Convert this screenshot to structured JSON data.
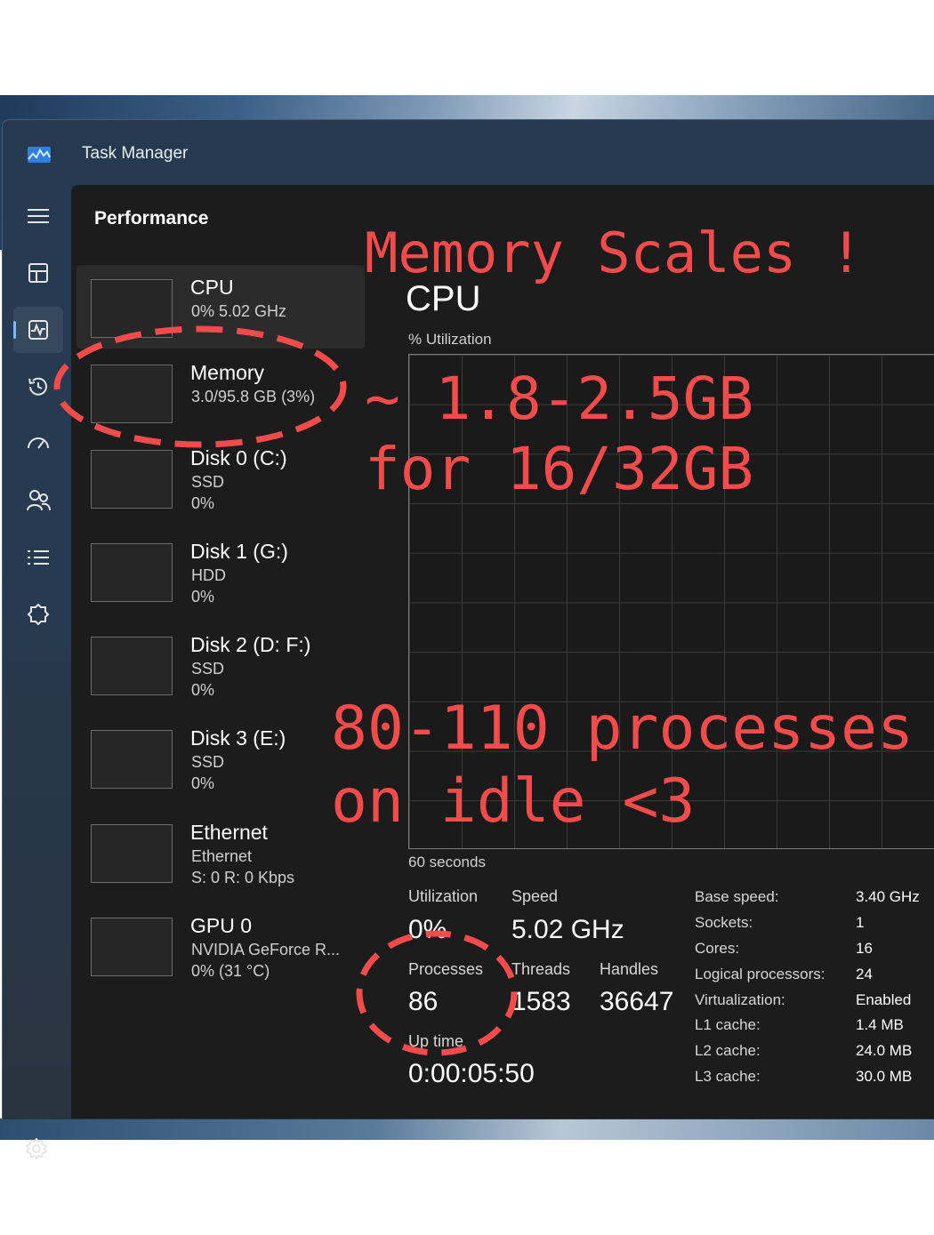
{
  "window": {
    "title": "Task Manager"
  },
  "page": {
    "title": "Performance"
  },
  "nav": {
    "items": [
      {
        "icon": "hamburger-menu-icon"
      },
      {
        "icon": "processes-icon"
      },
      {
        "icon": "performance-icon",
        "active": true
      },
      {
        "icon": "app-history-icon"
      },
      {
        "icon": "startup-apps-icon"
      },
      {
        "icon": "users-icon"
      },
      {
        "icon": "details-icon"
      },
      {
        "icon": "services-icon"
      }
    ],
    "settings_icon": "settings-gear-icon"
  },
  "resources": [
    {
      "name": "CPU",
      "sub1": "0%  5.02 GHz",
      "sub2": ""
    },
    {
      "name": "Memory",
      "sub1": "3.0/95.8 GB (3%)",
      "sub2": ""
    },
    {
      "name": "Disk 0 (C:)",
      "sub1": "SSD",
      "sub2": "0%"
    },
    {
      "name": "Disk 1 (G:)",
      "sub1": "HDD",
      "sub2": "0%"
    },
    {
      "name": "Disk 2 (D: F:)",
      "sub1": "SSD",
      "sub2": "0%"
    },
    {
      "name": "Disk 3 (E:)",
      "sub1": "SSD",
      "sub2": "0%"
    },
    {
      "name": "Ethernet",
      "sub1": "Ethernet",
      "sub2": "S: 0 R: 0 Kbps"
    },
    {
      "name": "GPU 0",
      "sub1": "NVIDIA GeForce R...",
      "sub2": "0%  (31 °C)"
    }
  ],
  "detail": {
    "title": "CPU",
    "graph_label": "% Utilization",
    "time_label": "60 seconds",
    "utilization_label": "Utilization",
    "utilization_value": "0%",
    "speed_label": "Speed",
    "speed_value": "5.02 GHz",
    "processes_label": "Processes",
    "processes_value": "86",
    "threads_label": "Threads",
    "threads_value": "1583",
    "handles_label": "Handles",
    "handles_value": "36647",
    "uptime_label": "Up time",
    "uptime_value": "0:00:05:50",
    "specs": [
      {
        "key": "Base speed:",
        "value": "3.40 GHz"
      },
      {
        "key": "Sockets:",
        "value": "1"
      },
      {
        "key": "Cores:",
        "value": "16"
      },
      {
        "key": "Logical processors:",
        "value": "24"
      },
      {
        "key": "Virtualization:",
        "value": "Enabled"
      },
      {
        "key": "L1 cache:",
        "value": "1.4 MB"
      },
      {
        "key": "L2 cache:",
        "value": "24.0 MB"
      },
      {
        "key": "L3 cache:",
        "value": "30.0 MB"
      }
    ]
  },
  "annotations": {
    "heading": "Memory Scales !",
    "memory_line1": "~ 1.8-2.5GB",
    "memory_line2": "for 16/32GB",
    "process_line1": "80-110 processes",
    "process_line2": "on idle <3",
    "color": "#f24b4b"
  },
  "colors": {
    "accent": "#7fb4ff",
    "panel": "#1c1c1c",
    "annotation": "#f24b4b"
  }
}
